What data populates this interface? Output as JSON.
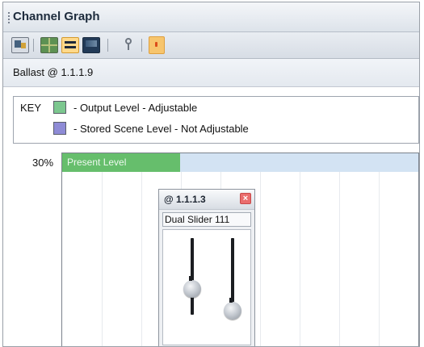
{
  "window": {
    "title": "Channel Graph"
  },
  "toolbar": {
    "icons": [
      "grid-properties-icon",
      "grid-view-icon",
      "list-view-icon",
      "display-icon",
      "user-icon",
      "alert-icon"
    ]
  },
  "device": {
    "label": "Ballast @ 1.1.1.9"
  },
  "legend": {
    "key_label": "KEY",
    "items": [
      {
        "label": "- Output Level - Adjustable",
        "color": "#7cc78f"
      },
      {
        "label": "- Stored Scene Level - Not Adjustable",
        "color": "#8e8bd6"
      }
    ]
  },
  "graph": {
    "percent_label": "30%",
    "present_level_label": "Present Level",
    "present_level_fraction": 0.33,
    "fill_color": "#66be6c",
    "track_color": "#d3e3f3"
  },
  "popup": {
    "title": "@ 1.1.1.3",
    "subtitle": "Dual Slider 111",
    "sliders": [
      {
        "name": "left",
        "level": 0.38
      },
      {
        "name": "right",
        "level": 0.1
      }
    ]
  }
}
